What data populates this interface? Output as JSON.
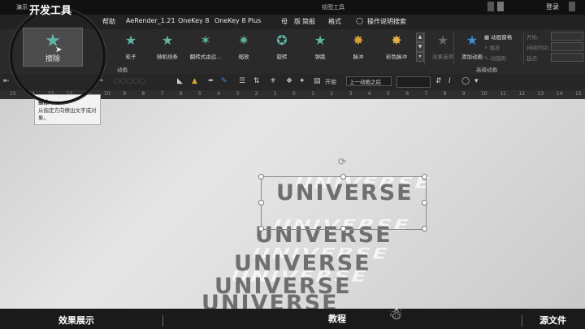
{
  "titlebar": {
    "app": "演示",
    "context_tab": "绘图工具",
    "login": "登录"
  },
  "menu": {
    "dev_tools": "开发工具",
    "items": [
      "帮助",
      "AeRender_1.21",
      "OneKey 8",
      "OneKey 8 Plus",
      "母",
      "版",
      "简报",
      "格式"
    ],
    "help_search": "操作说明搜索"
  },
  "ribbon": {
    "erase": "擦除",
    "animations": [
      {
        "label": "轮子",
        "icon": "wheel-icon"
      },
      {
        "label": "随机线条",
        "icon": "random-bars-icon"
      },
      {
        "label": "翻转式由远...",
        "icon": "flip-icon"
      },
      {
        "label": "缩放",
        "icon": "zoom-icon"
      },
      {
        "label": "旋转",
        "icon": "spin-icon"
      },
      {
        "label": "弹跳",
        "icon": "bounce-icon"
      },
      {
        "label": "脉冲",
        "icon": "pulse-icon"
      },
      {
        "label": "彩色脉冲",
        "icon": "color-pulse-icon"
      }
    ],
    "effect_options": "效果选项",
    "group_animation": "动画",
    "add_animation": "添加动画",
    "animation_pane": "动画窗格",
    "trigger": "触发",
    "animation_painter": "动画刷",
    "group_advanced": "高级动画",
    "timing_start": "开始:",
    "timing_duration": "持续时间:",
    "timing_delay": "延迟:"
  },
  "toolbar": {
    "start_label": "开始",
    "start_value": "上一动画之后"
  },
  "ruler": [
    "15",
    "14",
    "13",
    "12",
    "11",
    "10",
    "9",
    "8",
    "7",
    "6",
    "5",
    "4",
    "3",
    "2",
    "1",
    "0",
    "1",
    "2",
    "3",
    "4",
    "5",
    "6",
    "7",
    "8",
    "9",
    "10",
    "11",
    "12",
    "13",
    "14",
    "15"
  ],
  "tooltip": {
    "title": "擦除",
    "description": "从指定方向擦出文字或对象。"
  },
  "canvas": {
    "word": "UNIVERSE"
  },
  "bottom": {
    "left": "效果展示",
    "center": "教程",
    "right": "源文件"
  },
  "colors": {
    "accent_teal": "#5fb6a6",
    "gold": "#d9a13a",
    "blue": "#3f8fd9"
  }
}
